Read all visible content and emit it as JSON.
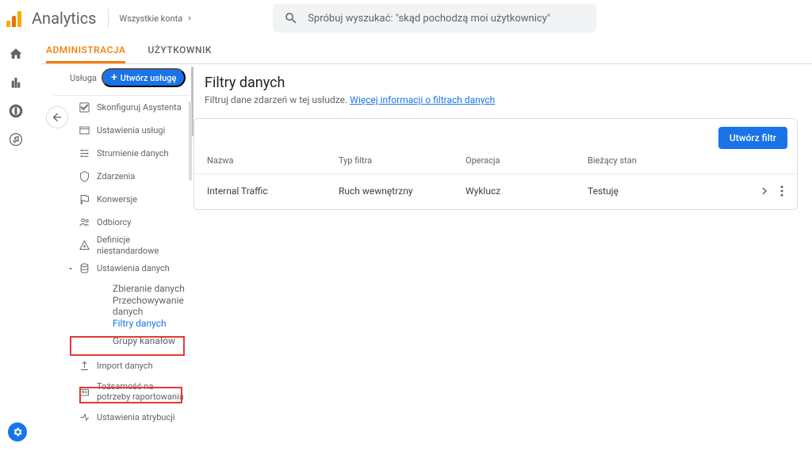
{
  "header": {
    "product": "Analytics",
    "breadcrumb": "Wszystkie konta",
    "search_placeholder": "Spróbuj wyszukać: \"skąd pochodzą moi użytkownicy\""
  },
  "tabs": {
    "admin": "ADMINISTRACJA",
    "user": "UŻYTKOWNIK"
  },
  "sidebar": {
    "service_label": "Usługa",
    "create_button": "Utwórz usługę",
    "items": [
      {
        "label": "Skonfiguruj Asystenta"
      },
      {
        "label": "Ustawienia usługi"
      },
      {
        "label": "Strumienie danych"
      },
      {
        "label": "Zdarzenia"
      },
      {
        "label": "Konwersje"
      },
      {
        "label": "Odbiorcy"
      },
      {
        "label": "Definicje niestandardowe"
      },
      {
        "label": "Ustawienia danych",
        "expanded": true,
        "children": [
          {
            "label": "Zbieranie danych"
          },
          {
            "label": "Przechowywanie danych"
          },
          {
            "label": "Filtry danych",
            "active": true
          },
          {
            "label": "Grupy kanałów"
          }
        ]
      },
      {
        "label": "Import danych"
      },
      {
        "label": "Tożsamość na potrzeby raportowania"
      },
      {
        "label": "Ustawienia atrybucji"
      }
    ]
  },
  "page": {
    "title": "Filtry danych",
    "subtitle": "Filtruj dane zdarzeń w tej usłudze.",
    "learn_more": "Więcej informacji o filtrach danych",
    "create_filter": "Utwórz filtr",
    "columns": {
      "name": "Nazwa",
      "type": "Typ filtra",
      "operation": "Operacja",
      "state": "Bieżący stan"
    },
    "rows": [
      {
        "name": "Internal Traffic",
        "type": "Ruch wewnętrzny",
        "operation": "Wyklucz",
        "state": "Testuję"
      }
    ]
  }
}
